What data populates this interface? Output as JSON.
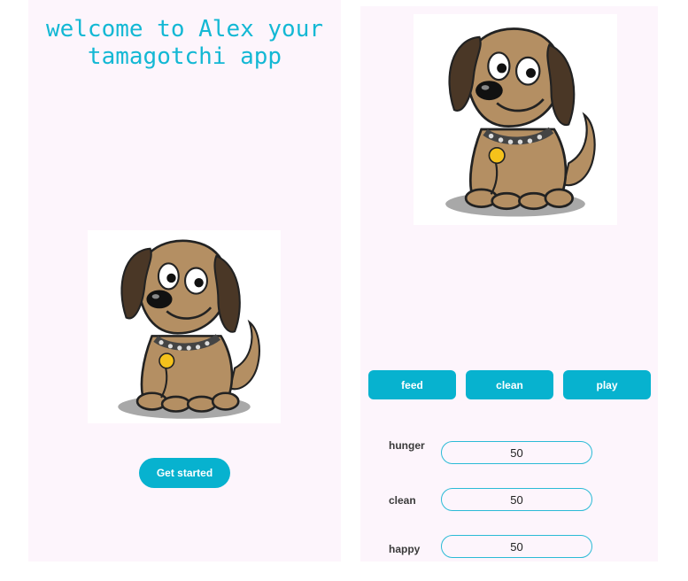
{
  "welcome_screen": {
    "title": "welcome to Alex your tamagotchi app",
    "get_started_label": "Get started"
  },
  "game_screen": {
    "actions": [
      {
        "label": "feed"
      },
      {
        "label": "clean"
      },
      {
        "label": "play"
      }
    ],
    "stats": [
      {
        "label": "hunger",
        "value": "50"
      },
      {
        "label": "clean",
        "value": "50"
      },
      {
        "label": "happy",
        "value": "50"
      }
    ]
  },
  "colors": {
    "accent": "#07b2cf",
    "background": "#fdf5fc",
    "title_text": "#13b8d4"
  },
  "images": [
    "cartoon-dog-pet"
  ]
}
